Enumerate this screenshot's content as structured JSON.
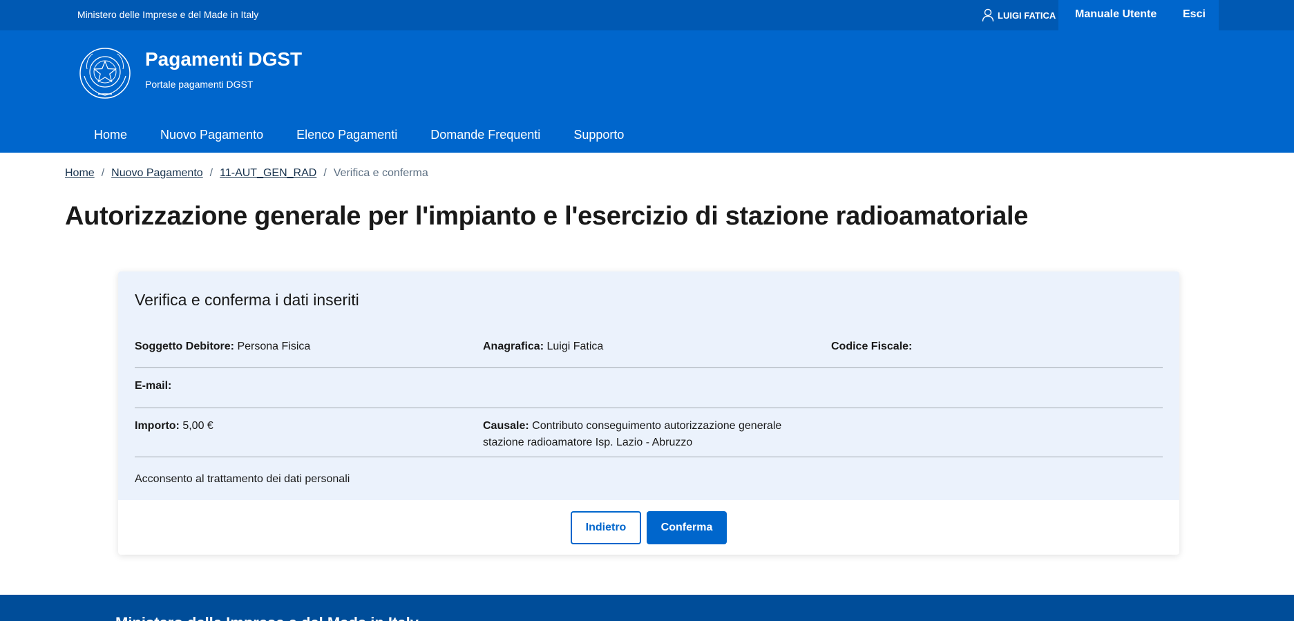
{
  "slim_header": {
    "ministry": "Ministero delle Imprese e del Made in Italy",
    "user_name": "LUIGI FATICA",
    "manual_label": "Manuale Utente",
    "logout_label": "Esci"
  },
  "brand": {
    "title": "Pagamenti DGST",
    "subtitle": "Portale pagamenti DGST"
  },
  "nav": [
    {
      "label": "Home"
    },
    {
      "label": "Nuovo Pagamento"
    },
    {
      "label": "Elenco Pagamenti"
    },
    {
      "label": "Domande Frequenti"
    },
    {
      "label": "Supporto"
    }
  ],
  "breadcrumb": [
    {
      "label": "Home"
    },
    {
      "label": "Nuovo Pagamento"
    },
    {
      "label": "11-AUT_GEN_RAD"
    },
    {
      "label": "Verifica e conferma"
    }
  ],
  "page_title": "Autorizzazione generale per l'impianto e l'esercizio di stazione radioamatoriale",
  "card": {
    "title": "Verifica e conferma i dati inseriti",
    "fields": {
      "soggetto_label": "Soggetto Debitore:",
      "soggetto_value": "Persona Fisica",
      "anagrafica_label": "Anagrafica:",
      "anagrafica_value": "Luigi Fatica",
      "cf_label": "Codice Fiscale:",
      "cf_value": "",
      "email_label": "E-mail:",
      "email_value": "",
      "importo_label": "Importo:",
      "importo_value": "5,00 €",
      "causale_label": "Causale:",
      "causale_value": "Contributo conseguimento autorizzazione generale stazione radioamatore Isp. Lazio - Abruzzo"
    },
    "consent": "Acconsento al trattamento dei dati personali",
    "back_label": "Indietro",
    "confirm_label": "Conferma"
  },
  "footer": {
    "ministry": "Ministero delle Imprese e del Made in Italy"
  },
  "colors": {
    "primary": "#0066cc",
    "slim": "#0059b3",
    "footer": "#004d99",
    "card_bg": "#ebf2fc"
  }
}
